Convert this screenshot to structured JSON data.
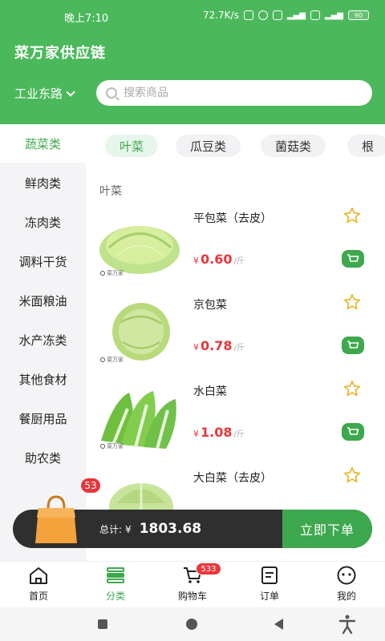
{
  "status_bar": {
    "time": "晚上7:10",
    "network_speed": "72.7K/s",
    "battery": "90"
  },
  "header": {
    "title": "菜万家供应链",
    "location": "工业东路",
    "search_placeholder": "搜索商品"
  },
  "sidebar": {
    "items": [
      {
        "label": "蔬菜类",
        "active": true
      },
      {
        "label": "鲜肉类"
      },
      {
        "label": "冻肉类"
      },
      {
        "label": "调料干货"
      },
      {
        "label": "米面粮油"
      },
      {
        "label": "水产冻类"
      },
      {
        "label": "其他食材"
      },
      {
        "label": "餐厨用品"
      },
      {
        "label": "助农类"
      }
    ]
  },
  "tabs": [
    {
      "label": "叶菜",
      "active": true
    },
    {
      "label": "瓜豆类"
    },
    {
      "label": "菌菇类"
    },
    {
      "label": "根"
    }
  ],
  "section": {
    "title": "叶菜"
  },
  "products": [
    {
      "name": "平包菜（去皮）",
      "currency": "¥",
      "price": "0.60",
      "unit": "/斤",
      "brand": "菜万家",
      "image": "cabbage"
    },
    {
      "name": "京包菜",
      "currency": "¥",
      "price": "0.78",
      "unit": "/斤",
      "brand": "菜万家",
      "image": "round-cabbage"
    },
    {
      "name": "水白菜",
      "currency": "¥",
      "price": "1.08",
      "unit": "/斤",
      "brand": "菜万家",
      "image": "bok-choy"
    },
    {
      "name": "大白菜（去皮）",
      "currency": "¥",
      "price": "",
      "unit": "",
      "brand": "",
      "image": "napa-cabbage"
    }
  ],
  "order_bar": {
    "bag_count": "53",
    "total_label": "总计:",
    "currency": "¥",
    "total_amount": "1803.68",
    "submit_label": "立即下单"
  },
  "bottom_nav": [
    {
      "label": "首页",
      "icon": "home-icon"
    },
    {
      "label": "分类",
      "icon": "category-icon",
      "active": true
    },
    {
      "label": "购物车",
      "icon": "cart-icon",
      "badge": "533"
    },
    {
      "label": "订单",
      "icon": "order-icon"
    },
    {
      "label": "我的",
      "icon": "profile-icon"
    }
  ],
  "colors": {
    "brand_green": "#4cb85c",
    "accent_green": "#3ea84e",
    "price_red": "#e8363a",
    "order_bar_dark": "#2f2f2f",
    "bag_orange": "#f4a23c"
  }
}
